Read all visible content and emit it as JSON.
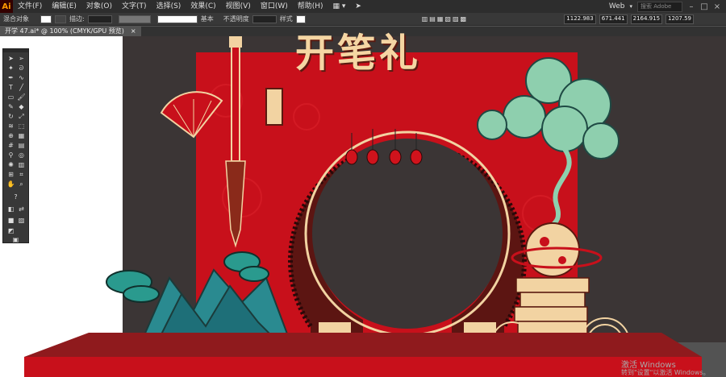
{
  "menubar": {
    "logo": "Ai",
    "items": [
      "文件(F)",
      "编辑(E)",
      "对象(O)",
      "文字(T)",
      "选择(S)",
      "效果(C)",
      "视图(V)",
      "窗口(W)",
      "帮助(H)"
    ],
    "workspace": "Web",
    "search_placeholder": "搜索 Adobe Stock"
  },
  "control_bar": {
    "selection": "混合对象",
    "stroke_label": "描边:",
    "stroke_style": "基本",
    "opacity_label": "不透明度",
    "style_label": "样式",
    "x_value": "1122.983",
    "y_value": "671.441",
    "w_value": "2164.915",
    "h_value": "1207.59"
  },
  "document_tab": {
    "filename": "开学 47.ai* @ 100% (CMYK/GPU 预览)",
    "close": "×"
  },
  "artwork": {
    "title": "开笔礼"
  },
  "activation_watermark": {
    "line1": "激活 Windows",
    "line2": "转到\"设置\"以激活 Windows。"
  },
  "colors": {
    "red": "#c8101b",
    "dark": "#3b3535",
    "cream": "#f2d3a2",
    "teal": "#2a9a8e",
    "floor": "#9e1c20"
  }
}
